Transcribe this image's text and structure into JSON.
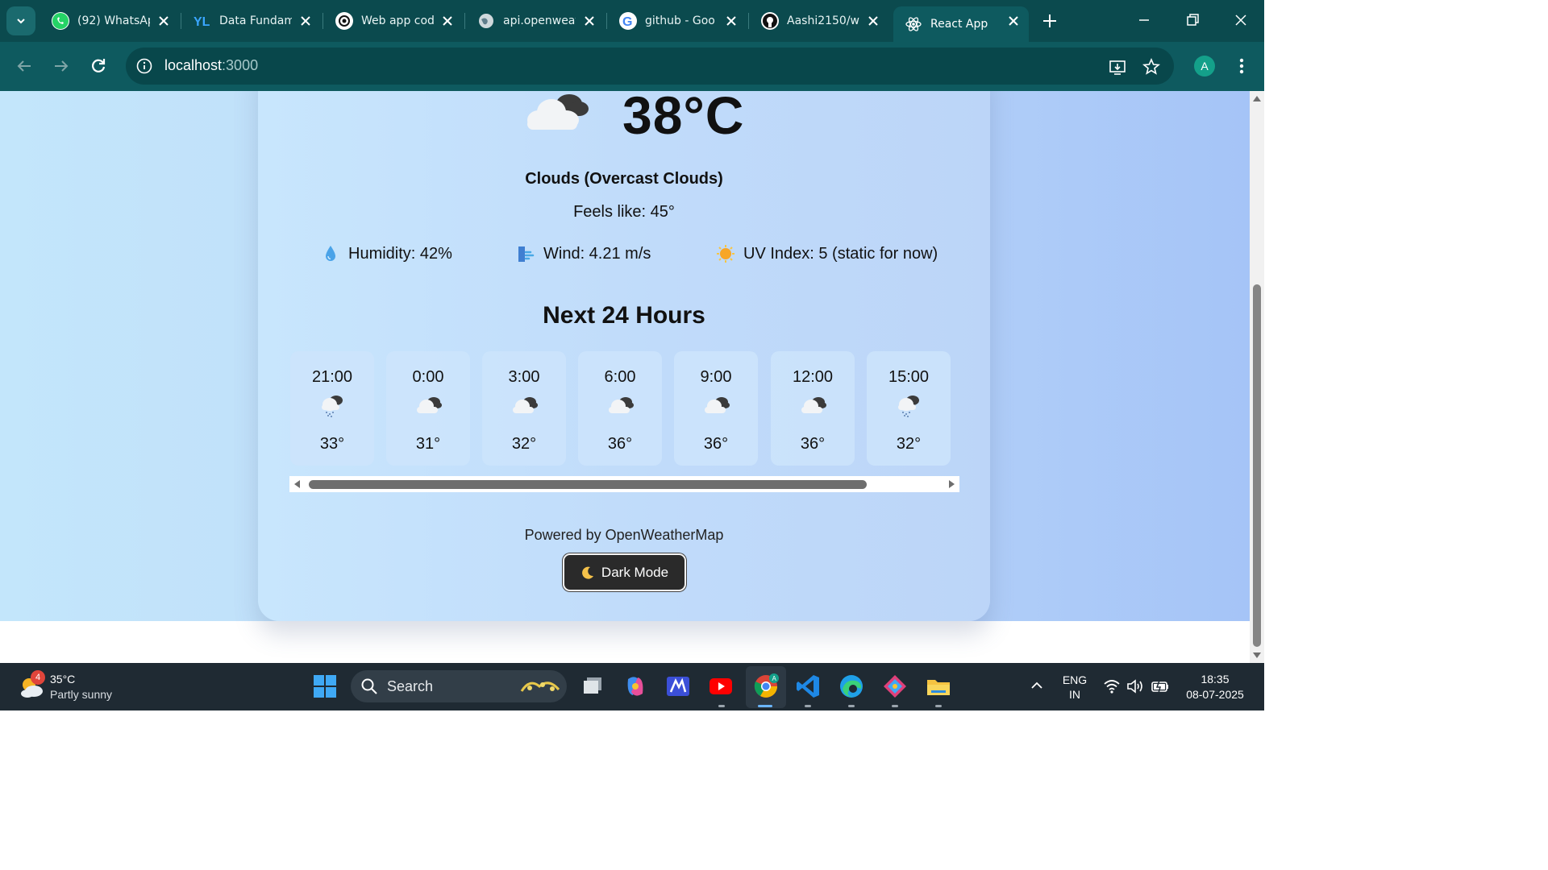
{
  "browser": {
    "tabs": [
      {
        "title": "(92) WhatsAp",
        "icon": "whatsapp-icon"
      },
      {
        "title": "Data Fundam",
        "icon": "yl-icon"
      },
      {
        "title": "Web app cod",
        "icon": "openai-icon"
      },
      {
        "title": "api.openweat",
        "icon": "globe-icon"
      },
      {
        "title": "github - Goo",
        "icon": "google-icon"
      },
      {
        "title": "Aashi2150/w",
        "icon": "github-icon"
      },
      {
        "title": "React App",
        "icon": "react-icon",
        "active": true
      }
    ],
    "url_host": "localhost",
    "url_port": ":3000",
    "profile_initial": "A",
    "accent": "#0e5a5f"
  },
  "weather": {
    "temperature": "38°C",
    "condition": "Clouds (Overcast Clouds)",
    "feels_like": "Feels like: 45°",
    "humidity": "Humidity: 42%",
    "wind": "Wind: 4.21 m/s",
    "uv": "UV Index: 5 (static for now)",
    "forecast_title": "Next 24 Hours",
    "forecast": [
      {
        "time": "21:00",
        "icon": "rain-cloud-icon",
        "temp": "33°"
      },
      {
        "time": "0:00",
        "icon": "cloud-icon",
        "temp": "31°"
      },
      {
        "time": "3:00",
        "icon": "cloud-icon",
        "temp": "32°"
      },
      {
        "time": "6:00",
        "icon": "cloud-icon",
        "temp": "36°"
      },
      {
        "time": "9:00",
        "icon": "cloud-icon",
        "temp": "36°"
      },
      {
        "time": "12:00",
        "icon": "cloud-icon",
        "temp": "36°"
      },
      {
        "time": "15:00",
        "icon": "rain-cloud-icon",
        "temp": "32°"
      }
    ],
    "powered_by": "Powered by OpenWeatherMap",
    "dark_mode_label": "Dark Mode"
  },
  "taskbar": {
    "widget_temp": "35°C",
    "widget_desc": "Partly sunny",
    "widget_badge": "4",
    "search_label": "Search",
    "lang_top": "ENG",
    "lang_bottom": "IN",
    "time": "18:35",
    "date": "08-07-2025"
  }
}
